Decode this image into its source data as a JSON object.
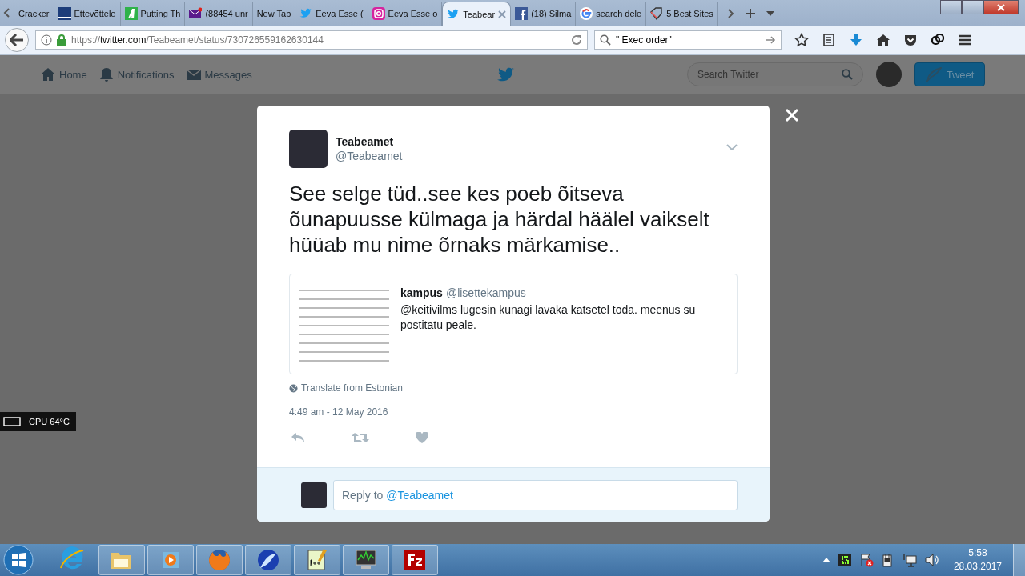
{
  "browser": {
    "tabs": [
      {
        "label": "Cracker",
        "selected": false
      },
      {
        "label": "Ettevõttele",
        "selected": false
      },
      {
        "label": "Putting Th",
        "selected": false
      },
      {
        "label": "(88454 unr",
        "selected": false
      },
      {
        "label": "New Tab",
        "selected": false
      },
      {
        "label": "Eeva Esse (",
        "selected": false
      },
      {
        "label": "Eeva Esse o",
        "selected": false
      },
      {
        "label": "Teabear",
        "selected": true
      },
      {
        "label": "(18) Silma",
        "selected": false
      },
      {
        "label": "search dele",
        "selected": false
      },
      {
        "label": "5 Best Sites",
        "selected": false
      }
    ],
    "url_scheme": "https://",
    "url_host": "twitter.com",
    "url_path": "/Teabeamet/status/730726559162630144",
    "search_value": "\" Exec order\""
  },
  "twitter_header": {
    "nav": [
      {
        "label": "Home"
      },
      {
        "label": "Notifications"
      },
      {
        "label": "Messages"
      }
    ],
    "search_placeholder": "Search Twitter",
    "tweet_button": "Tweet"
  },
  "cpu_widget": "CPU 64°C",
  "tweet": {
    "name": "Teabeamet",
    "handle": "@Teabeamet",
    "text": "See selge tüd..see kes poeb õitseva õunapuusse külmaga ja härdal häälel vaikselt hüüab mu nime õrnaks märkamise..",
    "quote": {
      "name": "kampus",
      "handle": "@lisettekampus",
      "text": "@keitivilms lugesin kunagi lavaka katsetel toda. meenus su postitatu peale."
    },
    "translate": "Translate from Estonian",
    "timestamp": "4:49 am - 12 May 2016",
    "reply": {
      "prefix": "Reply to",
      "mention": "@Teabeamet"
    }
  },
  "taskbar": {
    "time": "5:58",
    "date": "28.03.2017"
  }
}
